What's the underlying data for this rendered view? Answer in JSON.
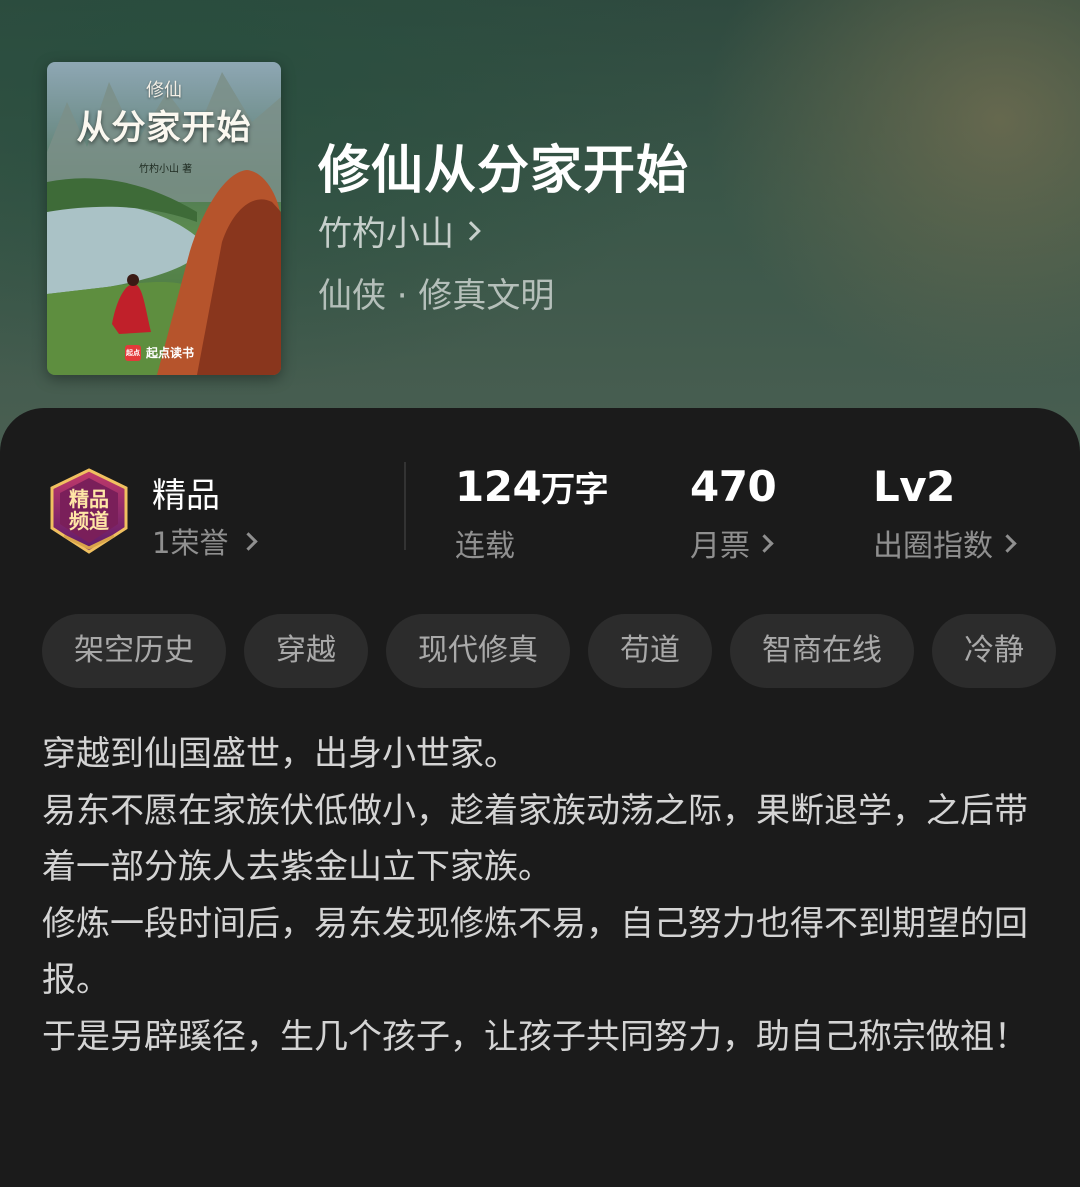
{
  "book": {
    "title": "修仙从分家开始",
    "author": "竹杓小山",
    "genre": "仙侠 · 修真文明"
  },
  "cover": {
    "series": "修仙",
    "title": "从分家开始",
    "author": "竹杓小山 著",
    "brand": "起点读书",
    "brand_logo_text": "起点"
  },
  "quality": {
    "badge_icon": "premium-channel-badge-icon",
    "label": "精品",
    "honor": "1荣誉"
  },
  "stats": [
    {
      "value": "124",
      "unit": "万字",
      "label": "连载",
      "has_chevron": false
    },
    {
      "value": "470",
      "unit": "",
      "label": "月票",
      "has_chevron": true
    },
    {
      "value": "Lv2",
      "unit": "",
      "label": "出圈指数",
      "has_chevron": true
    }
  ],
  "tags": [
    "架空历史",
    "穿越",
    "现代修真",
    "苟道",
    "智商在线",
    "冷静"
  ],
  "synopsis": "穿越到仙国盛世，出身小世家。\n易东不愿在家族伏低做小，趁着家族动荡之际，果断退学，之后带着一部分族人去紫金山立下家族。\n修炼一段时间后，易东发现修炼不易，自己努力也得不到期望的回报。\n于是另辟蹊径，生几个孩子，让孩子共同努力，助自己称宗做祖！",
  "colors": {
    "background": "#1b1b1b",
    "tag_bg": "#2c2c2c",
    "muted_text": "#8f8f8f"
  }
}
